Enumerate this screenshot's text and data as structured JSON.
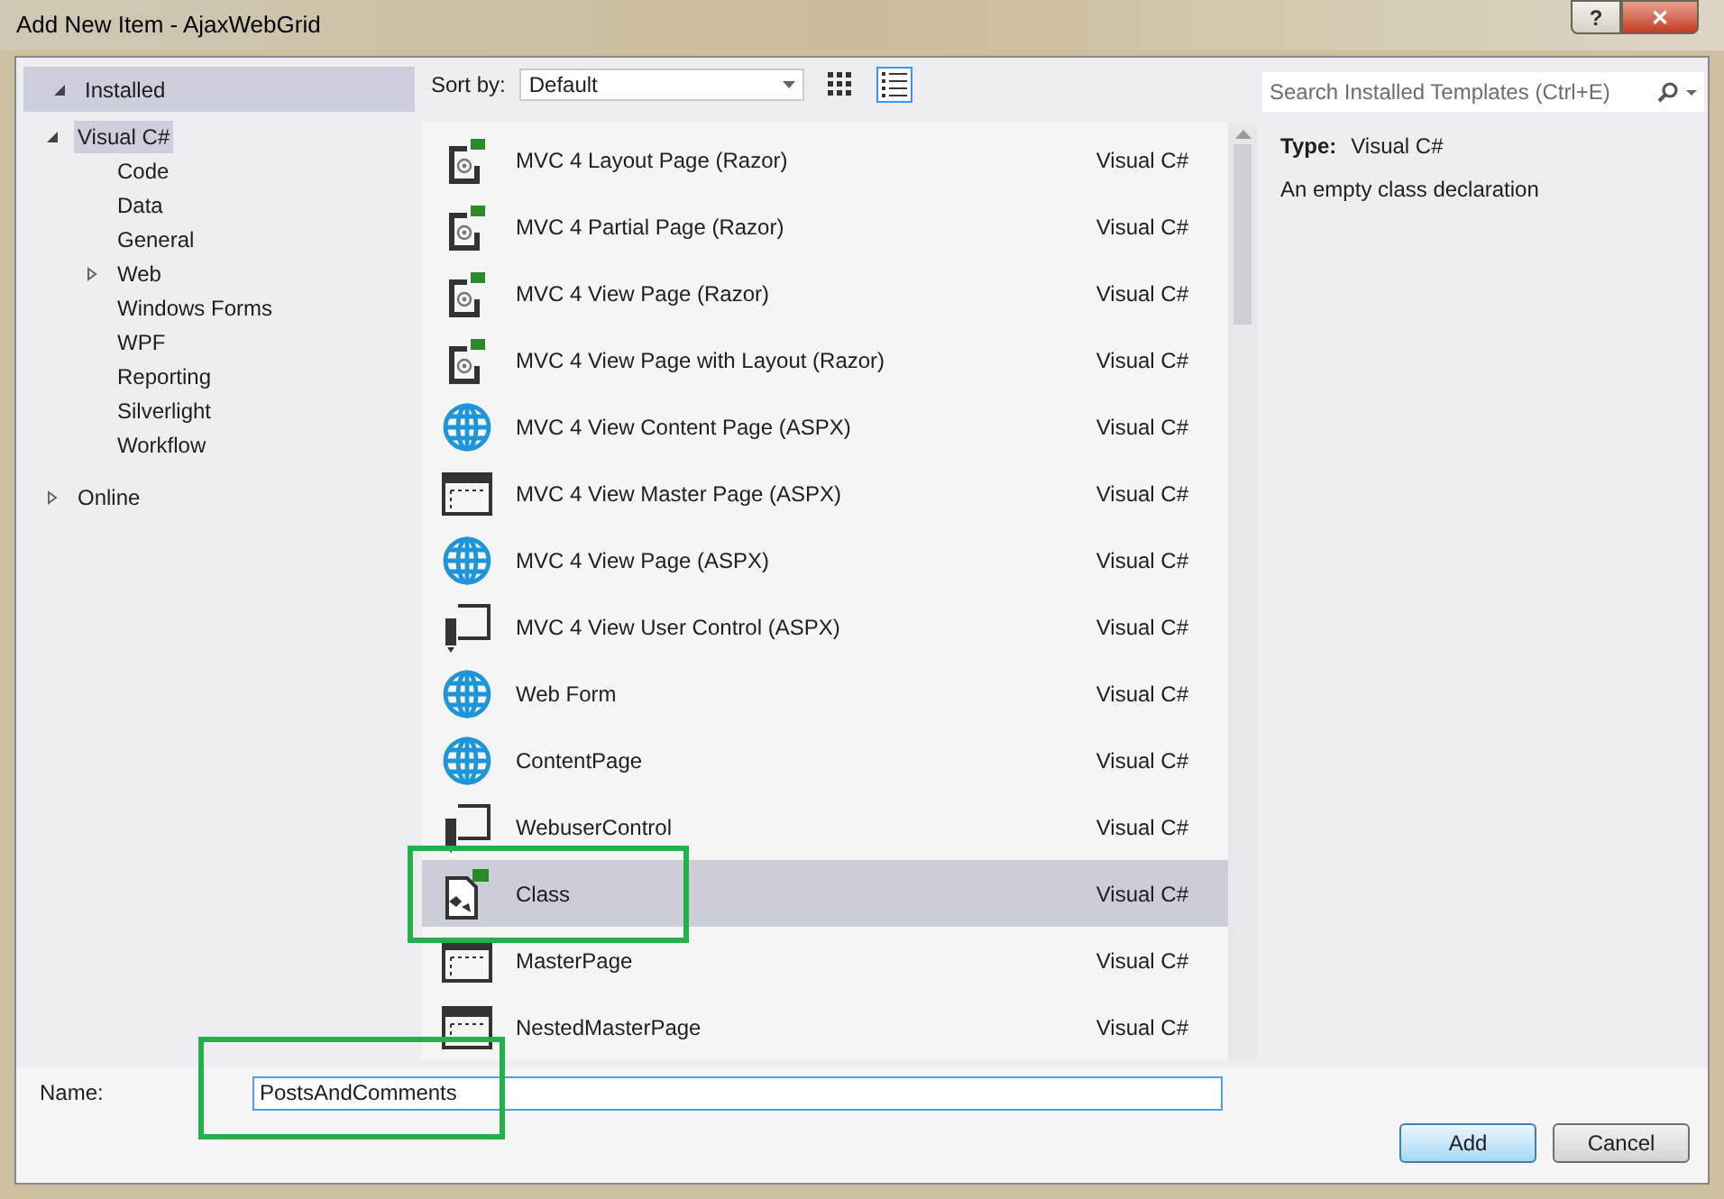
{
  "window": {
    "title": "Add New Item - AjaxWebGrid",
    "buttons": [
      {
        "kind": "help",
        "label": "?"
      },
      {
        "kind": "close",
        "label": "✕"
      }
    ]
  },
  "tree": [
    {
      "label": "Installed",
      "expanded": true,
      "header": true,
      "children": [
        {
          "label": "Visual C#",
          "expanded": true,
          "selected": true,
          "children": [
            {
              "label": "Code",
              "selected": false
            },
            {
              "label": "Data",
              "selected": false
            },
            {
              "label": "General",
              "selected": false
            },
            {
              "label": "Web",
              "selected": false,
              "expanded": false
            },
            {
              "label": "Windows Forms",
              "selected": false
            },
            {
              "label": "WPF",
              "selected": false
            },
            {
              "label": "Reporting",
              "selected": false
            },
            {
              "label": "Silverlight",
              "selected": false
            },
            {
              "label": "Workflow",
              "selected": false
            }
          ]
        }
      ]
    },
    {
      "label": "Online",
      "expanded": false,
      "header": false
    }
  ],
  "toolbar": {
    "sort_label": "Sort by:",
    "sort_value": "Default",
    "views": [
      {
        "kind": "grid",
        "selected": false
      },
      {
        "kind": "list",
        "selected": true
      }
    ]
  },
  "search": {
    "placeholder": "Search Installed Templates (Ctrl+E)"
  },
  "templates": [
    {
      "name": "MVC 4 Layout Page (Razor)",
      "type": "Visual C#",
      "kind": "razor",
      "selected": false
    },
    {
      "name": "MVC 4 Partial Page (Razor)",
      "type": "Visual C#",
      "kind": "razor",
      "selected": false
    },
    {
      "name": "MVC 4 View Page (Razor)",
      "type": "Visual C#",
      "kind": "razor",
      "selected": false
    },
    {
      "name": "MVC 4 View Page with Layout (Razor)",
      "type": "Visual C#",
      "kind": "razor",
      "selected": false
    },
    {
      "name": "MVC 4 View Content Page (ASPX)",
      "type": "Visual C#",
      "kind": "globe",
      "selected": false
    },
    {
      "name": "MVC 4 View Master Page (ASPX)",
      "type": "Visual C#",
      "kind": "master",
      "selected": false
    },
    {
      "name": "MVC 4 View Page (ASPX)",
      "type": "Visual C#",
      "kind": "globe",
      "selected": false
    },
    {
      "name": "MVC 4 View User Control (ASPX)",
      "type": "Visual C#",
      "kind": "control",
      "selected": false
    },
    {
      "name": "Web Form",
      "type": "Visual C#",
      "kind": "globe",
      "selected": false
    },
    {
      "name": "ContentPage",
      "type": "Visual C#",
      "kind": "globe",
      "selected": false
    },
    {
      "name": "WebuserControl",
      "type": "Visual C#",
      "kind": "control",
      "selected": false
    },
    {
      "name": "Class",
      "type": "Visual C#",
      "kind": "class",
      "selected": true,
      "highlighted": true
    },
    {
      "name": "MasterPage",
      "type": "Visual C#",
      "kind": "master",
      "selected": false
    },
    {
      "name": "NestedMasterPage",
      "type": "Visual C#",
      "kind": "master",
      "selected": false
    }
  ],
  "details": {
    "type_label": "Type:",
    "type_value": "Visual C#",
    "description": "An empty class declaration"
  },
  "name_field": {
    "label": "Name:",
    "value": "PostsAndComments",
    "highlighted": true
  },
  "buttons": [
    {
      "label": "Add",
      "default": true
    },
    {
      "label": "Cancel",
      "default": false
    }
  ]
}
